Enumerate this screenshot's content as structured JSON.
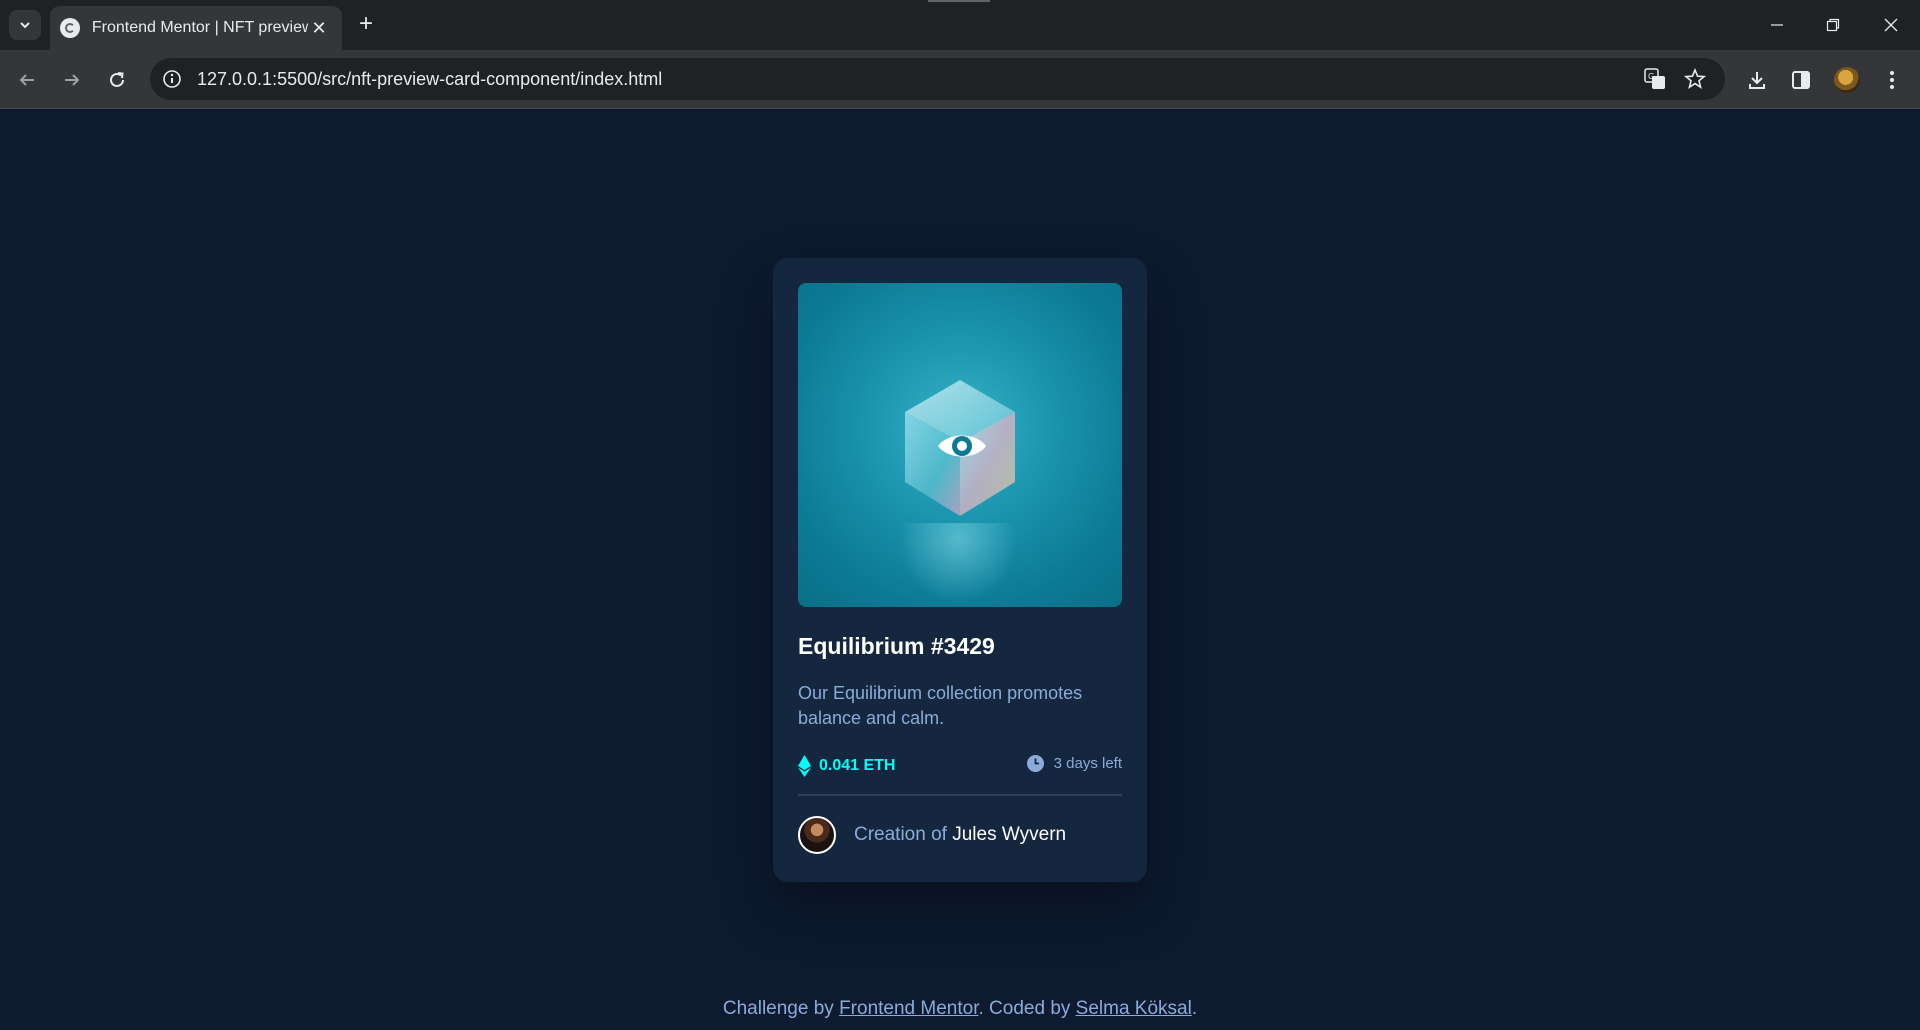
{
  "browser": {
    "tab_title": "Frontend Mentor | NFT preview",
    "url": "127.0.0.1:5500/src/nft-preview-card-component/index.html"
  },
  "icons": {
    "tab_list": "chevron-down-icon",
    "favicon": "frontend-mentor-favicon",
    "close": "close-icon",
    "new_tab": "plus-icon",
    "back": "arrow-left-icon",
    "forward": "arrow-right-icon",
    "reload": "reload-icon",
    "site_info": "info-icon",
    "translate": "translate-icon",
    "bookmark": "star-icon",
    "download": "download-icon",
    "side_panel": "side-panel-icon",
    "menu": "more-vertical-icon",
    "ethereum": "ethereum-icon",
    "clock": "clock-icon",
    "view": "eye-icon"
  },
  "card": {
    "title": "Equilibrium #3429",
    "description": "Our Equilibrium collection promotes balance and calm.",
    "price": "0.041 ETH",
    "time_left": "3 days left",
    "creator_prefix": "Creation of",
    "creator_name": "Jules Wyvern"
  },
  "footer": {
    "prefix": "Challenge by ",
    "link1": "Frontend Mentor",
    "middle": ". Coded by ",
    "link2": "Selma Köksal",
    "suffix": "."
  },
  "colors": {
    "page_bg": "#0d1a2f",
    "card_bg": "#15263f",
    "accent_cyan": "#00fff8",
    "soft_blue": "#8bacd9",
    "white": "#ffffff"
  }
}
